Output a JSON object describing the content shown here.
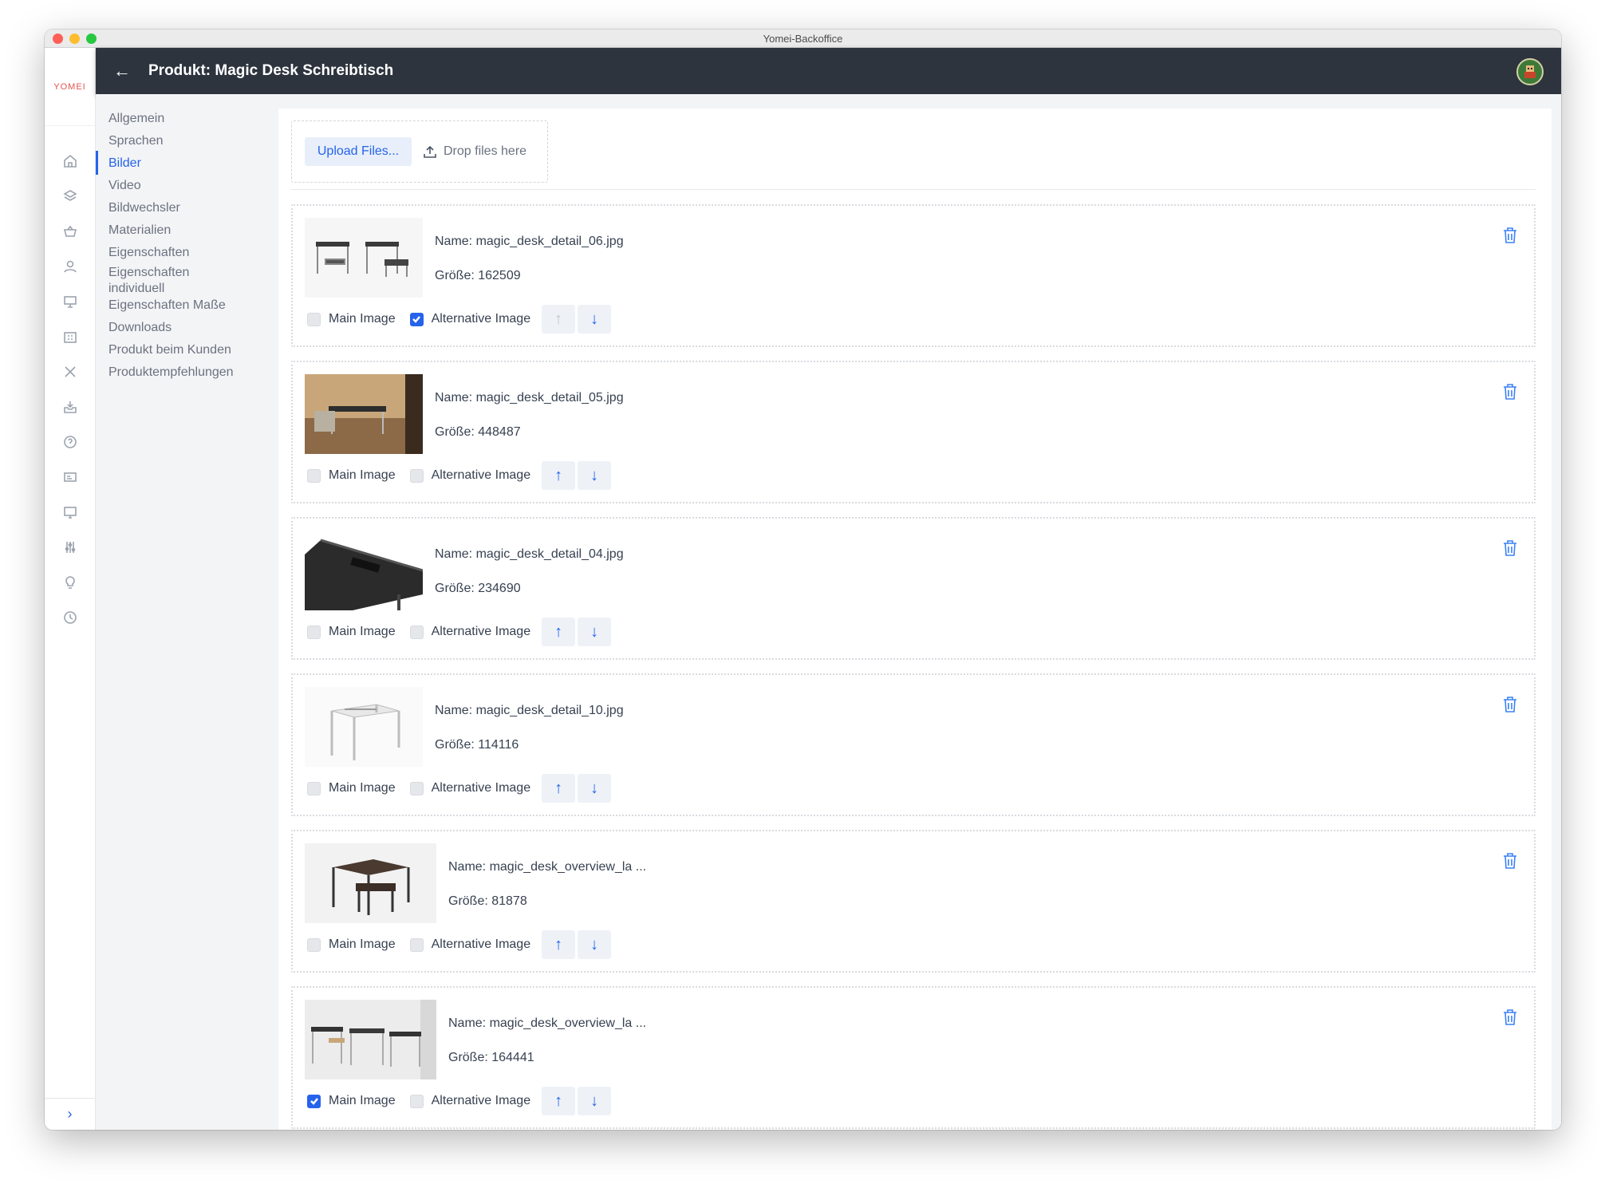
{
  "window": {
    "title": "Yomei-Backoffice"
  },
  "logo": {
    "text": "YOMEI"
  },
  "header": {
    "title": "Produkt: Magic Desk Schreibtisch"
  },
  "nav_icons": [
    "home-icon",
    "layers-icon",
    "basket-icon",
    "user-icon",
    "presentation-icon",
    "building-icon",
    "tools-icon",
    "inbox-icon",
    "help-icon",
    "id-card-icon",
    "monitor-icon",
    "sliders-icon",
    "bulb-icon",
    "clock-icon"
  ],
  "menu": {
    "items": [
      {
        "label": "Allgemein",
        "active": false
      },
      {
        "label": "Sprachen",
        "active": false
      },
      {
        "label": "Bilder",
        "active": true
      },
      {
        "label": "Video",
        "active": false
      },
      {
        "label": "Bildwechsler",
        "active": false
      },
      {
        "label": "Materialien",
        "active": false
      },
      {
        "label": "Eigenschaften",
        "active": false
      },
      {
        "label": "Eigenschaften individuell",
        "active": false
      },
      {
        "label": "Eigenschaften Maße",
        "active": false
      },
      {
        "label": "Downloads",
        "active": false
      },
      {
        "label": "Produkt beim Kunden",
        "active": false
      },
      {
        "label": "Produktempfehlungen",
        "active": false
      }
    ]
  },
  "upload": {
    "button_label": "Upload Files...",
    "drop_label": "Drop files here"
  },
  "labels": {
    "main_image": "Main Image",
    "alternative_image": "Alternative Image"
  },
  "accent_color": "#2563eb",
  "images": [
    {
      "name": "Name: magic_desk_detail_06.jpg",
      "size": "Größe: 162509",
      "main": false,
      "alternative": true,
      "up_enabled": false
    },
    {
      "name": "Name: magic_desk_detail_05.jpg",
      "size": "Größe: 448487",
      "main": false,
      "alternative": false,
      "up_enabled": true
    },
    {
      "name": "Name: magic_desk_detail_04.jpg",
      "size": "Größe: 234690",
      "main": false,
      "alternative": false,
      "up_enabled": true
    },
    {
      "name": "Name: magic_desk_detail_10.jpg",
      "size": "Größe: 114116",
      "main": false,
      "alternative": false,
      "up_enabled": true
    },
    {
      "name": "Name: magic_desk_overview_la ...",
      "size": "Größe: 81878",
      "main": false,
      "alternative": false,
      "up_enabled": true
    },
    {
      "name": "Name: magic_desk_overview_la ...",
      "size": "Größe: 164441",
      "main": true,
      "alternative": false,
      "up_enabled": true
    }
  ]
}
